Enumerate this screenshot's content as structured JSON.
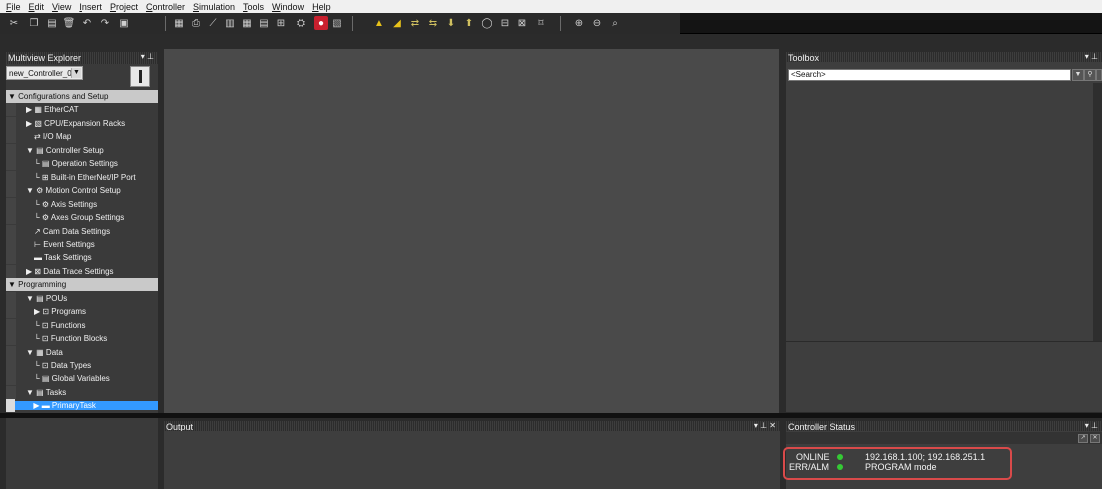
{
  "menu": [
    "File",
    "Edit",
    "View",
    "Insert",
    "Project",
    "Controller",
    "Simulation",
    "Tools",
    "Window",
    "Help"
  ],
  "menu_underline": [
    "F",
    "E",
    "V",
    "I",
    "P",
    "C",
    "S",
    "T",
    "W",
    "H"
  ],
  "toolbar": {
    "buttons": [
      {
        "icon": "cut-icon",
        "glyph": "✂"
      },
      {
        "icon": "copy-icon",
        "glyph": "❐"
      },
      {
        "icon": "paste-icon",
        "glyph": "▤"
      },
      {
        "icon": "delete-icon",
        "glyph": "🗑"
      },
      {
        "icon": "undo-icon",
        "glyph": "↶"
      },
      {
        "icon": "redo-icon",
        "glyph": "↷"
      },
      {
        "icon": "save-icon",
        "glyph": "▣"
      },
      {
        "icon": "build-icon",
        "glyph": "▦"
      },
      {
        "icon": "print-icon",
        "glyph": "⎙"
      },
      {
        "icon": "wrench-icon",
        "glyph": "⟋"
      },
      {
        "icon": "compare-icon",
        "glyph": "▥"
      },
      {
        "icon": "grid-icon",
        "glyph": "▦"
      },
      {
        "icon": "table-icon",
        "glyph": "▤"
      },
      {
        "icon": "network-icon",
        "glyph": "⊞"
      },
      {
        "icon": "binoculars-icon",
        "glyph": "⛭"
      },
      {
        "icon": "stop-icon",
        "glyph": "●"
      },
      {
        "icon": "monitor-icon",
        "glyph": "▧"
      },
      {
        "icon": "online-icon",
        "glyph": "▲"
      },
      {
        "icon": "offline-icon",
        "glyph": "◢"
      },
      {
        "icon": "sync-icon",
        "glyph": "⇄"
      },
      {
        "icon": "transfer-icon",
        "glyph": "⇆"
      },
      {
        "icon": "download-icon",
        "glyph": "⬇"
      },
      {
        "icon": "upload-icon",
        "glyph": "⬆"
      },
      {
        "icon": "reset-icon",
        "glyph": "◯"
      },
      {
        "icon": "compare-verify-icon",
        "glyph": "⊟"
      },
      {
        "icon": "settings-icon",
        "glyph": "⊠"
      },
      {
        "icon": "window-icon",
        "glyph": "⌑"
      },
      {
        "icon": "zoom-in-icon",
        "glyph": "⊕"
      },
      {
        "icon": "zoom-out-icon",
        "glyph": "⊖"
      },
      {
        "icon": "find-icon",
        "glyph": "⌕"
      }
    ]
  },
  "explorer": {
    "title": "Multiview Explorer",
    "pin": "▾ ⊥",
    "controller": "new_Controller_0",
    "tree": [
      {
        "label": "Configurations and Setup",
        "type": "section",
        "prefix": "▼"
      },
      {
        "label": "EtherCAT",
        "prefix": "▶ ▦",
        "indent": 2
      },
      {
        "label": "CPU/Expansion Racks",
        "prefix": "▶ ▧",
        "indent": 2
      },
      {
        "label": "I/O Map",
        "prefix": "⇄",
        "indent": 3
      },
      {
        "label": "Controller Setup",
        "prefix": "▼ ▤",
        "indent": 2
      },
      {
        "label": "Operation Settings",
        "prefix": "└ ▤",
        "indent": 3
      },
      {
        "label": "Built-in EtherNet/IP Port",
        "prefix": "└ ⊞",
        "indent": 3
      },
      {
        "label": "Motion Control Setup",
        "prefix": "▼ ⚙",
        "indent": 2
      },
      {
        "label": "Axis Settings",
        "prefix": "└ ⚙",
        "indent": 3
      },
      {
        "label": "Axes Group Settings",
        "prefix": "└ ⚙",
        "indent": 3
      },
      {
        "label": "Cam Data Settings",
        "prefix": "↗",
        "indent": 3
      },
      {
        "label": "Event Settings",
        "prefix": "⊢",
        "indent": 3
      },
      {
        "label": "Task Settings",
        "prefix": "▬",
        "indent": 3
      },
      {
        "label": "Data Trace Settings",
        "prefix": "▶ ⊠",
        "indent": 2
      },
      {
        "label": "Programming",
        "type": "section",
        "prefix": "▼"
      },
      {
        "label": "POUs",
        "prefix": "▼ ▤",
        "indent": 2
      },
      {
        "label": "Programs",
        "prefix": "▶ ⊡",
        "indent": 3
      },
      {
        "label": "Functions",
        "prefix": "└ ⊡",
        "indent": 3
      },
      {
        "label": "Function Blocks",
        "prefix": "└ ⊡",
        "indent": 3
      },
      {
        "label": "Data",
        "prefix": "▼ ▦",
        "indent": 2
      },
      {
        "label": "Data Types",
        "prefix": "└ ⊡",
        "indent": 3
      },
      {
        "label": "Global Variables",
        "prefix": "└ ▤",
        "indent": 3
      },
      {
        "label": "Tasks",
        "prefix": "▼ ▤",
        "indent": 2
      },
      {
        "label": "PrimaryTask",
        "prefix": "▶ ▬",
        "indent": 3,
        "selected": true
      }
    ]
  },
  "toolbox": {
    "title": "Toolbox",
    "pin": "▾ ⊥",
    "search_placeholder": "<Search>"
  },
  "output": {
    "title": "Output",
    "pin": "▾ ⊥ ✕"
  },
  "controller_status": {
    "title": "Controller Status",
    "pin": "▾ ⊥",
    "rows": [
      {
        "label": "ONLINE",
        "dot_color": "#35c935",
        "value": "192.168.1.100; 192.168.251.1"
      },
      {
        "label": "ERR/ALM",
        "dot_color": "#35c935",
        "value": "PROGRAM mode"
      }
    ]
  }
}
